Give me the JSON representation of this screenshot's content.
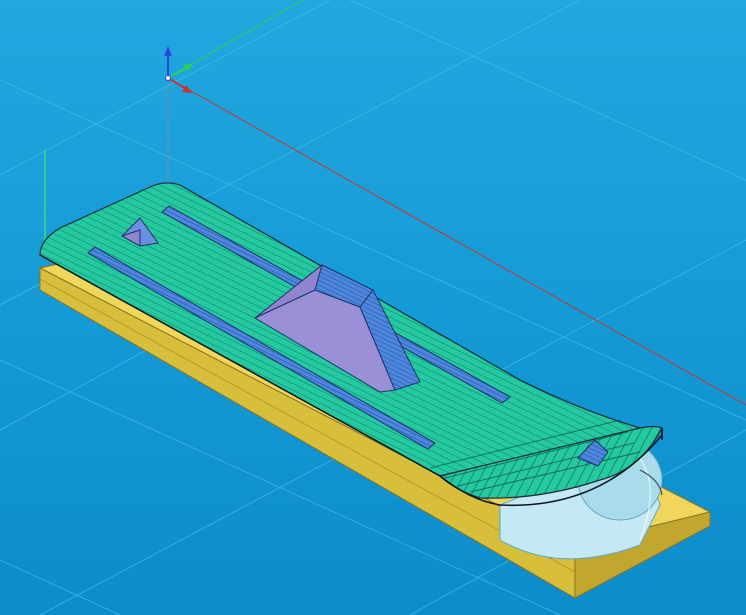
{
  "viewport": {
    "type": "3d-cam-viewport",
    "background_top": "#22a7df",
    "background_bottom": "#0e8ccb"
  },
  "axes": {
    "x_color": "#d0322d",
    "y_color": "#2fd14f",
    "z_color": "#2c46d8"
  },
  "model": {
    "stock_color": "#d8bf3b",
    "toolpath_surface_color": "#24c9a0",
    "pocket_color": "#3f76d4",
    "boss_face_color": "#8f84d0",
    "cylinder_color": "#bfe4f2",
    "edge_color": "#1d2a3a"
  }
}
